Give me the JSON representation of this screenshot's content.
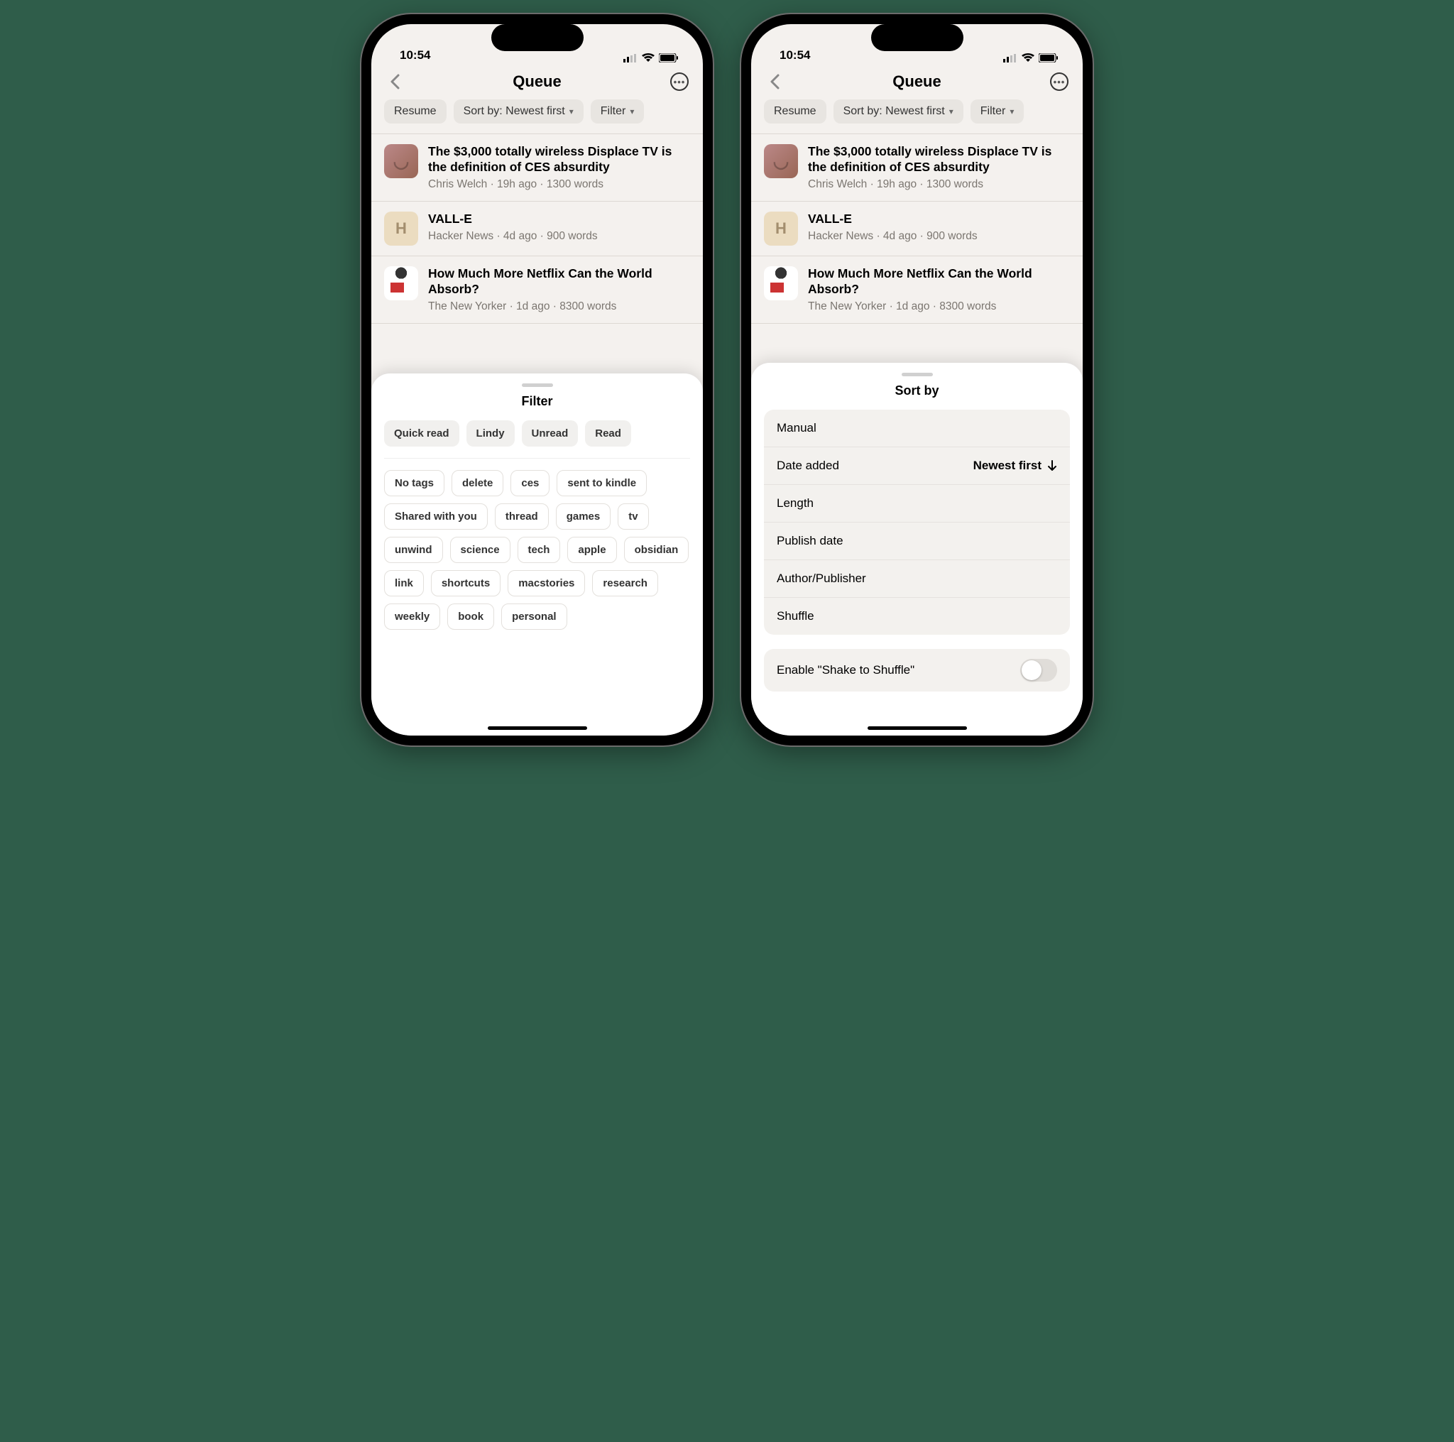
{
  "status": {
    "time": "10:54"
  },
  "nav": {
    "title": "Queue"
  },
  "toolbar": {
    "resume": "Resume",
    "sort": "Sort by: Newest first",
    "filter": "Filter"
  },
  "articles": [
    {
      "title": "The $3,000 totally wireless Displace TV is the definition of CES absurdity",
      "meta": "Chris Welch · 19h ago · 1300 words"
    },
    {
      "title": "VALL-E",
      "meta": "Hacker News · 4d ago · 900 words"
    },
    {
      "title": "How Much More Netflix Can the World Absorb?",
      "meta": "The New Yorker · 1d ago · 8300 words"
    }
  ],
  "filterSheet": {
    "title": "Filter",
    "quick": [
      "Quick read",
      "Lindy",
      "Unread",
      "Read"
    ],
    "tags": [
      "No tags",
      "delete",
      "ces",
      "sent to kindle",
      "Shared with you",
      "thread",
      "games",
      "tv",
      "unwind",
      "science",
      "tech",
      "apple",
      "obsidian",
      "link",
      "shortcuts",
      "macstories",
      "research",
      "weekly",
      "book",
      "personal"
    ]
  },
  "sortSheet": {
    "title": "Sort by",
    "options": [
      {
        "label": "Manual"
      },
      {
        "label": "Date added",
        "value": "Newest first"
      },
      {
        "label": "Length"
      },
      {
        "label": "Publish date"
      },
      {
        "label": "Author/Publisher"
      },
      {
        "label": "Shuffle"
      }
    ],
    "shake": "Enable \"Shake to Shuffle\""
  }
}
